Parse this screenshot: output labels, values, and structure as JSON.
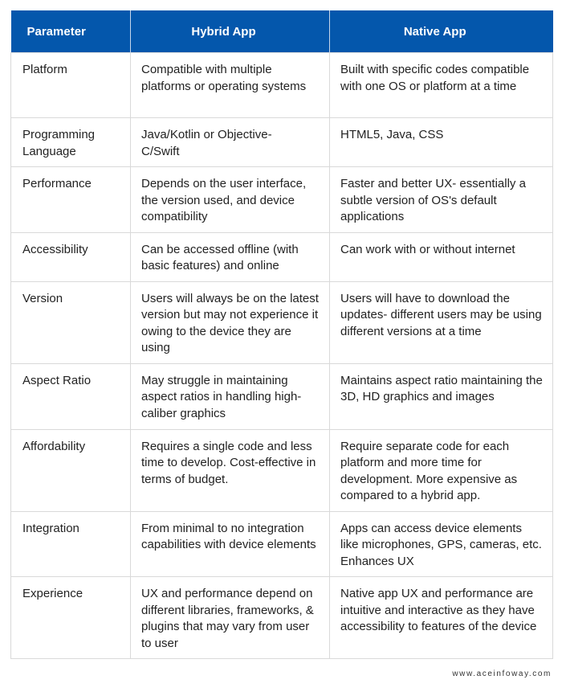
{
  "table": {
    "headers": [
      "Parameter",
      "Hybrid App",
      "Native App"
    ],
    "rows": [
      {
        "parameter": "Platform",
        "hybrid": "Compatible with multiple platforms or operating systems",
        "native": "Built with specific codes compatible with one OS or platform at a time"
      },
      {
        "parameter": "Programming Language",
        "hybrid": "Java/Kotlin or Objective-C/Swift",
        "native": "HTML5, Java, CSS"
      },
      {
        "parameter": "Performance",
        "hybrid": "Depends on the user interface, the version used, and device compatibility",
        "native": "Faster and better UX- essentially a subtle version of OS's default applications"
      },
      {
        "parameter": "Accessibility",
        "hybrid": "Can be accessed offline (with basic features) and online",
        "native": "Can work with or without internet"
      },
      {
        "parameter": "Version",
        "hybrid": "Users will always be on the latest version but may not experience it owing to the device they are using",
        "native": "Users will have to download the updates- different users may be using different versions at a time"
      },
      {
        "parameter": "Aspect Ratio",
        "hybrid": "May struggle in maintaining aspect ratios in handling high-caliber graphics",
        "native": "Maintains aspect ratio maintaining the 3D, HD graphics and images"
      },
      {
        "parameter": "Affordability",
        "hybrid": "Requires a single code and less time to develop. Cost-effective in terms of budget.",
        "native": "Require separate code for each platform and more time for development. More expensive as compared to a hybrid app."
      },
      {
        "parameter": "Integration",
        "hybrid": "From minimal to no integration capabilities with device elements",
        "native": "Apps can access device elements like microphones, GPS, cameras, etc. Enhances UX"
      },
      {
        "parameter": "Experience",
        "hybrid": "UX and performance depend on different libraries, frameworks, & plugins that may vary from user to user",
        "native": "Native app UX and performance are intuitive and interactive as they have accessibility to features of the device"
      }
    ]
  },
  "footer": {
    "website": "www.aceinfoway.com"
  },
  "colors": {
    "header_bg": "#0457ac",
    "header_text": "#ffffff",
    "border": "#d9d9d9",
    "body_text": "#222222"
  }
}
